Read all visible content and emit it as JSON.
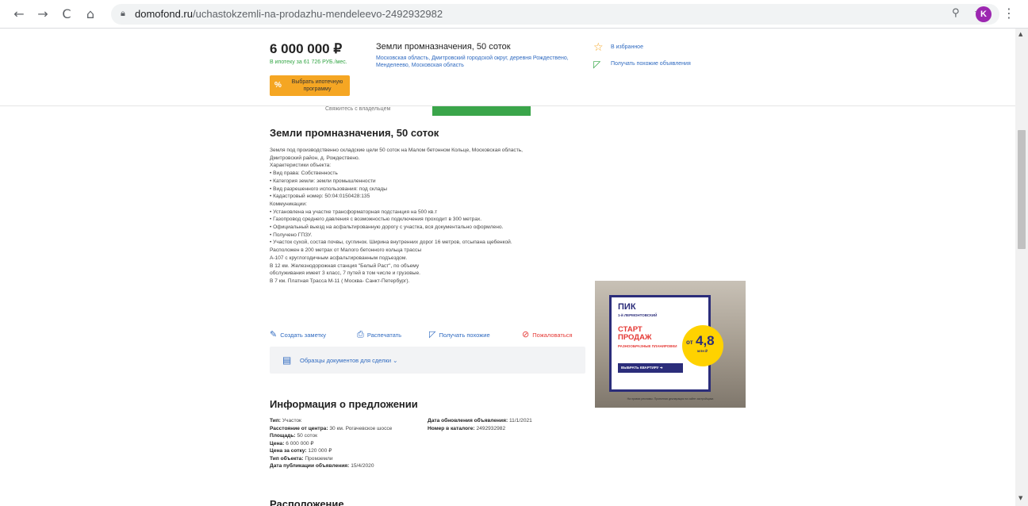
{
  "browser": {
    "back": "←",
    "forward": "→",
    "reload": "C",
    "home": "⌂",
    "url_host": "domofond.ru",
    "url_path": "/uchastokzemli-na-prodazhu-mendeleevo-2492932982",
    "zoom_icon": "zoom-icon",
    "star_icon": "☆",
    "avatar_letter": "K",
    "menu": "⋮"
  },
  "header": {
    "price": "6 000 000 ₽",
    "mortgage_line": "В ипотеку за 61 726 РУБ./мес.",
    "mortgage_button": "Выбрать ипотечную программу",
    "title": "Земли промназначения, 50 соток",
    "location": "Московская область, Дмитровский городской округ, деревня Рождествено, Менделеево, Московская область",
    "favorites": "В избранное",
    "similar": "Получать похожие объявления"
  },
  "peek": {
    "text": "Свяжитесь с владельцем"
  },
  "listing": {
    "title": "Земли промназначения, 50 соток",
    "description": [
      "Земля под производственно складские цели 50 соток на Малом бетонном Кольце, Московская область,",
      "Дмитровский район, д. Рождествено.",
      "Характеристики объекта:",
      "• Вид права: Собственность",
      "• Категория земли: земли промышленности",
      "• Вид разрешенного использования: под склады",
      "• Кадастровый номер: 50:04:0150428:135",
      "Коммуникации:",
      "• Установлена на участке трансформаторная подстанция на 500 кв.т",
      "• Газопровод среднего давления с возможностью подключения проходит в 300 метрах.",
      "• Официальный выезд на асфальтированную дорогу с участка, вся документально оформлено.",
      "• Получено ГПЗУ.",
      "• Участок сухой, состав почвы, суглинок. Ширина внутренних дорог 16 метров, отсыпана щебенкой.",
      "Расположен в 200 метрах от Малого бетонного кольца трассы",
      "А-107 с круглогодичным асфальтированным подъездом.",
      "В 12 км. Железнодорожная станция \"Белый Раст\", по объему",
      "обслуживания имеет 3 класс, 7 путей в том числе и грузовые.",
      "В 7 км. Платная Трасса М-11 ( Москва- Санкт-Петербург)."
    ]
  },
  "actions": {
    "note": "Создать заметку",
    "print": "Распечатать",
    "similar": "Получать похожие",
    "report": "Пожаловаться"
  },
  "docs": {
    "label": "Образцы документов для сделки"
  },
  "info": {
    "title": "Информация о предложении",
    "left": [
      {
        "label": "Тип:",
        "value": "Участок"
      },
      {
        "label": "Расстояние от центра:",
        "value": "30 км. Рогачевское шоссе"
      },
      {
        "label": "Площадь:",
        "value": "50 соток"
      },
      {
        "label": "Цена:",
        "value": "6 000 000 ₽"
      },
      {
        "label": "Цена за сотку:",
        "value": "120 000 ₽"
      },
      {
        "label": "Тип объекта:",
        "value": "Промземли"
      },
      {
        "label": "Дата публикации объявления:",
        "value": "15/4/2020"
      }
    ],
    "right": [
      {
        "label": "Дата обновления объявления:",
        "value": "11/1/2021"
      },
      {
        "label": "Номер в каталоге:",
        "value": "2492932982"
      }
    ]
  },
  "bottom": {
    "title": "Расположение"
  },
  "ad": {
    "logo": "ПИК",
    "subtitle": "1-й ЛЕРМОНТОВСКИЙ",
    "headline1": "СТАРТ",
    "headline2": "ПРОДАЖ",
    "small": "РАЗНООБРАЗНЫЕ ПЛАНИРОВКИ",
    "button": "ВЫБРАТЬ КВАРТИРУ ➜",
    "from": "от",
    "price": "4,8",
    "unit": "млн ₽",
    "footer": "На правах рекламы. Проектная декларация на сайте застройщика"
  }
}
